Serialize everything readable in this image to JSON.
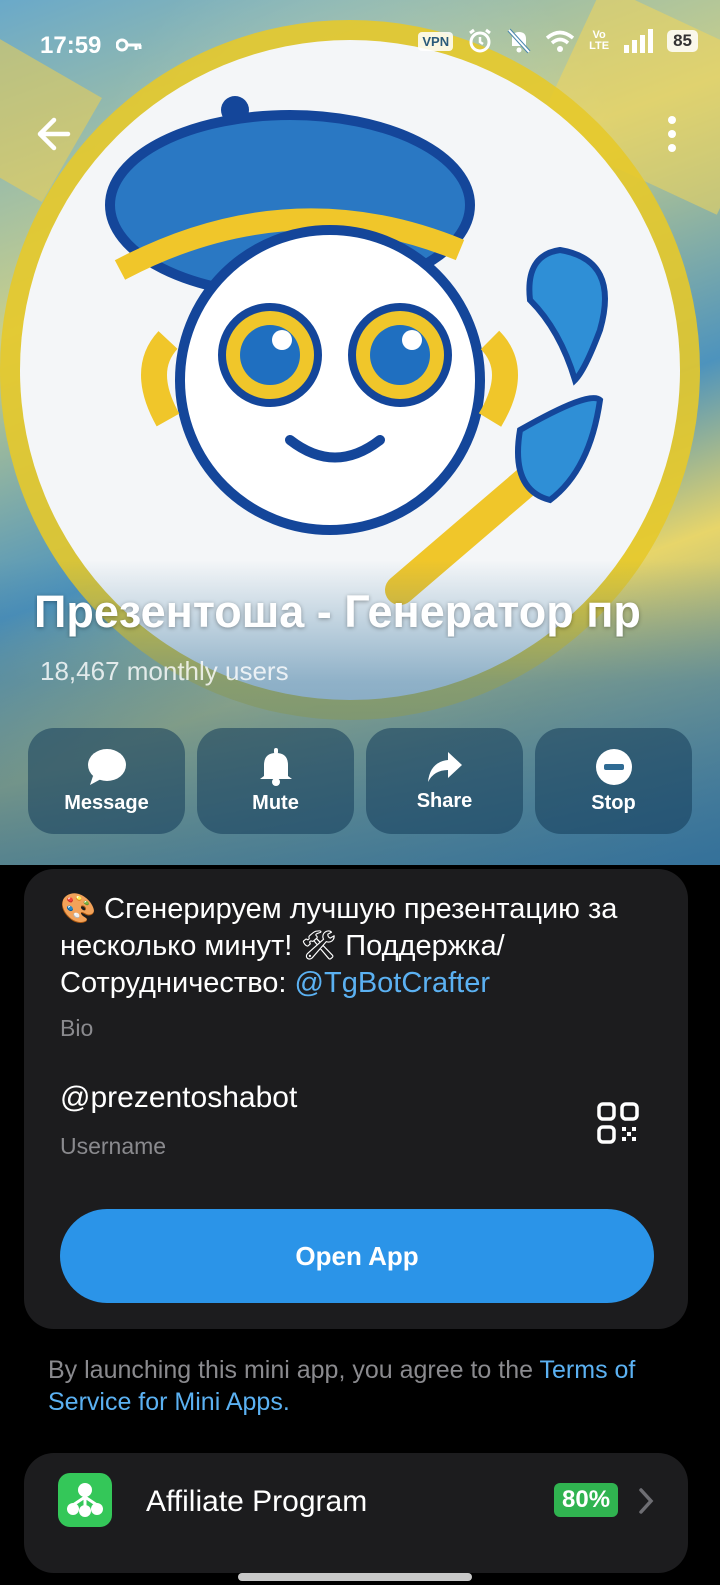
{
  "status_bar": {
    "time": "17:59",
    "vpn": "VPN",
    "volte": "Vo\nLTE",
    "battery": "85"
  },
  "header": {
    "title": "Презентоша - Генератор пр",
    "subtitle": "18,467 monthly users"
  },
  "actions": [
    {
      "label": "Message",
      "icon": "message-icon"
    },
    {
      "label": "Mute",
      "icon": "bell-icon"
    },
    {
      "label": "Share",
      "icon": "share-icon"
    },
    {
      "label": "Stop",
      "icon": "stop-icon"
    }
  ],
  "info": {
    "bio_text": "🎨 Сгенерируем лучшую презентацию за несколько минут! 🛠 Поддержка/Сотрудничество: ",
    "bio_link": "@TgBotCrafter",
    "bio_caption": "Bio",
    "username": "@prezentoshabot",
    "username_caption": "Username",
    "open_app_label": "Open App"
  },
  "terms": {
    "text": "By launching this mini app, you agree to the ",
    "link": "Terms of Service for Mini Apps",
    "suffix": "."
  },
  "affiliate": {
    "label": "Affiliate Program",
    "badge": "80%"
  },
  "colors": {
    "accent": "#2b94e8",
    "link": "#5bb1f2",
    "card_bg": "#1c1c1e",
    "badge_green": "#30b350"
  }
}
